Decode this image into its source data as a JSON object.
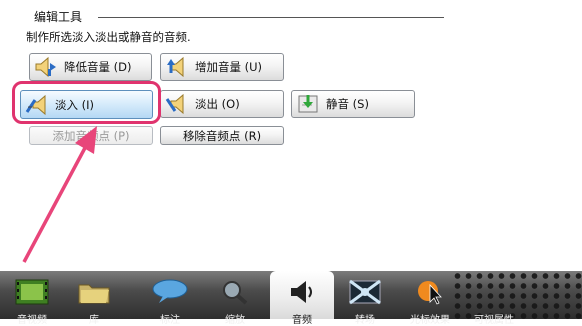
{
  "group": {
    "title": "编辑工具"
  },
  "description": "制作所选淡入淡出或静音的音频.",
  "buttons": {
    "decrease_volume": "降低音量 (D)",
    "increase_volume": "增加音量 (U)",
    "fade_in": "淡入 (I)",
    "fade_out": "淡出 (O)",
    "mute": "静音 (S)",
    "add_point": "添加音频点 (P)",
    "remove_point": "移除音频点 (R)"
  },
  "taskbar": {
    "tabs": [
      {
        "label": "音视频",
        "icon": "film-icon"
      },
      {
        "label": "库",
        "icon": "folder-icon"
      },
      {
        "label": "标注",
        "icon": "speech-bubble-icon"
      },
      {
        "label": "缩放",
        "icon": "magnifier-icon"
      },
      {
        "label": "音频",
        "icon": "speaker-icon",
        "active": true
      },
      {
        "label": "转场",
        "icon": "transition-icon"
      },
      {
        "label": "光标效果",
        "icon": "cursor-effect-icon"
      },
      {
        "label": "可视属性",
        "icon": "visual-properties-icon"
      }
    ]
  },
  "colors": {
    "highlight": "#e0336e",
    "arrow": "#e8457a",
    "selected_button": "#b4d8f4"
  }
}
